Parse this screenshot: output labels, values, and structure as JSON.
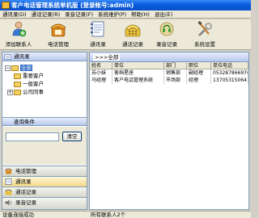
{
  "window": {
    "title": "客户电话管理系统单机版 (登录帐号:admin)"
  },
  "menu": [
    "通讯录(D)",
    "通话记录(R)",
    "录音记录(F)",
    "系统维护(P)",
    "帮助(H)",
    "退出(E)"
  ],
  "toolbar": [
    {
      "label": "添加联系人",
      "icon": "add-contact-icon"
    },
    {
      "label": "电话管理",
      "icon": "phone-icon"
    },
    {
      "label": "通讯录",
      "icon": "address-book-icon"
    },
    {
      "label": "通话记录",
      "icon": "call-log-icon"
    },
    {
      "label": "录音记录",
      "icon": "recording-icon"
    },
    {
      "label": "系统设置",
      "icon": "settings-icon"
    }
  ],
  "left_pane": {
    "header": "通讯录",
    "tree": {
      "root": "全部",
      "children": [
        "重要客户",
        "一般客户",
        "公司同事"
      ]
    },
    "search_header": "查询条件",
    "search_input": {
      "value": "",
      "placeholder": ""
    },
    "search_button": "清空",
    "nav": [
      "电话管理",
      "通讯录",
      "通话记录",
      "录音记录"
    ]
  },
  "right_pane": {
    "breadcrumb": ">>>全部",
    "columns": [
      "姓名",
      "单位",
      "部门",
      "职位",
      "单位电话"
    ],
    "rows": [
      [
        "苏小妹",
        "客档星座",
        "销售部",
        "副经理",
        "053287866976"
      ],
      [
        "马经理",
        "客户电话管理系统",
        "市场部",
        "经理",
        "13705315064"
      ]
    ]
  },
  "status": {
    "left": "设备连接成功",
    "right": "所有联系人2个"
  },
  "colors": {
    "title_bar": "#0a5fe0",
    "selection": "#316ac5",
    "active_nav": "#f4d888"
  }
}
